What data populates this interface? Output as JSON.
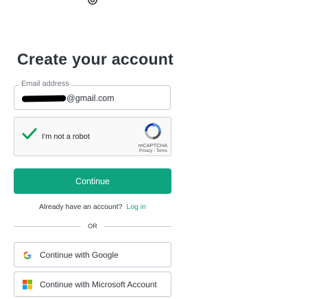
{
  "page": {
    "title": "Create your account"
  },
  "email": {
    "label": "Email address",
    "value_suffix": "@gmail.com"
  },
  "captcha": {
    "label": "I'm not a robot",
    "brand": "reCAPTCHA",
    "links": "Privacy - Terms"
  },
  "actions": {
    "continue_label": "Continue"
  },
  "signin": {
    "prompt": "Already have an account?",
    "link_label": "Log in"
  },
  "divider": {
    "label": "OR"
  },
  "social": {
    "google_label": "Continue with Google",
    "microsoft_label": "Continue with Microsoft Account"
  },
  "colors": {
    "accent": "#10a37f",
    "border": "#c2c8d0",
    "text": "#2d333a"
  }
}
